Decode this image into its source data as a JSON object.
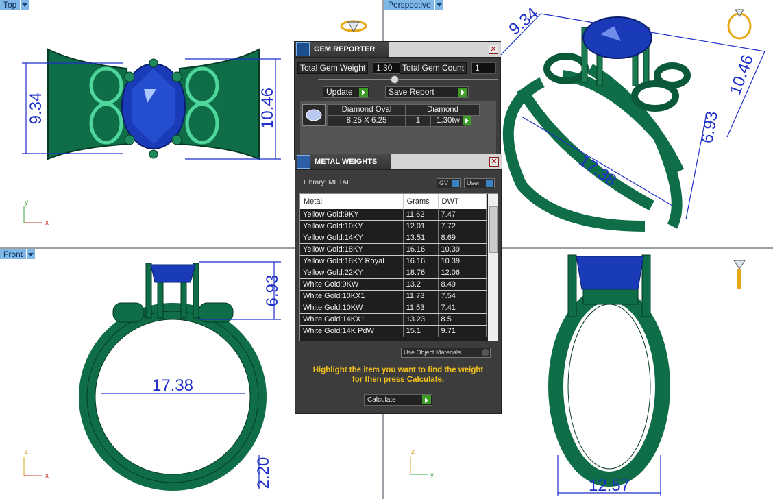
{
  "viewports": {
    "top": {
      "label": "Top",
      "dims": [
        "9.34",
        "10.46"
      ]
    },
    "perspective": {
      "label": "Perspective",
      "dims": [
        "9.34",
        "10.46",
        "6.93",
        "17.38"
      ]
    },
    "front": {
      "label": "Front",
      "dims": [
        "6.93",
        "17.38",
        "2.20"
      ]
    },
    "right": {
      "dims": [
        "12.57"
      ]
    }
  },
  "axes": {
    "top": [
      "y",
      "x"
    ],
    "front": [
      "z",
      "x"
    ],
    "right": [
      "z",
      "y"
    ]
  },
  "gem_reporter": {
    "title": "GEM REPORTER",
    "total_weight_label": "Total Gem Weight",
    "total_weight_value": "1.30",
    "total_count_label": "Total Gem Count",
    "total_count_value": "1",
    "update_label": "Update",
    "save_label": "Save Report",
    "gem": {
      "name": "Diamond Oval",
      "size": "8.25 X 6.25",
      "type": "Diamond",
      "qty": "1",
      "ctw": "1.30tw"
    }
  },
  "metal_weights": {
    "title": "METAL WEIGHTS",
    "library": "Library: METAL",
    "gv_label": "GV",
    "user_label": "User",
    "columns": [
      "Metal",
      "Grams",
      "DWT"
    ],
    "rows": [
      [
        "Yellow Gold:9KY",
        "11.62",
        "7.47"
      ],
      [
        "Yellow Gold:10KY",
        "12.01",
        "7.72"
      ],
      [
        "Yellow Gold:14KY",
        "13.51",
        "8.69"
      ],
      [
        "Yellow Gold:18KY",
        "16.16",
        "10.39"
      ],
      [
        "Yellow Gold:18KY Royal",
        "16.16",
        "10.39"
      ],
      [
        "Yellow Gold:22KY",
        "18.76",
        "12.06"
      ],
      [
        "White Gold:9KW",
        "13.2",
        "8.49"
      ],
      [
        "White Gold:10KX1",
        "11.73",
        "7.54"
      ],
      [
        "White Gold:10KW",
        "11.53",
        "7.41"
      ],
      [
        "White Gold:14KX1",
        "13.23",
        "8.5"
      ],
      [
        "White Gold:14K PdW",
        "15.1",
        "9.71"
      ]
    ],
    "use_object_materials": "Use Object Materials",
    "hint": "Highlight the item you want to find the weight for then press Calculate.",
    "calculate_label": "Calculate"
  },
  "colors": {
    "ring": "#0f6e48",
    "gem": "#1a3bb8",
    "dimension": "#1f2fc9",
    "accent": "#f0c01c"
  }
}
